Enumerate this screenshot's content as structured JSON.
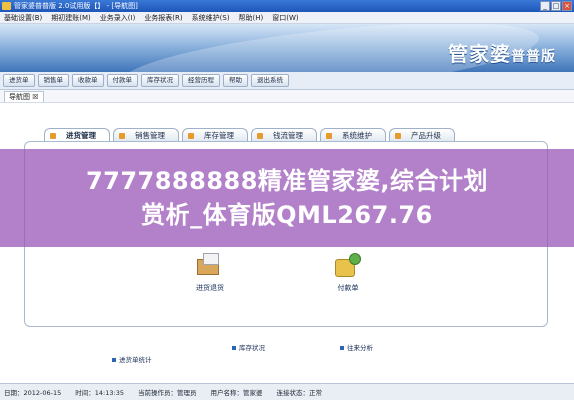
{
  "window": {
    "title": "管家婆普普版 2.0试用版【】 - [导航图]",
    "buttons": [
      "_",
      "□",
      "×"
    ]
  },
  "menubar": {
    "items": [
      "基础设置(B)",
      "期初建账(M)",
      "业务录入(I)",
      "业务报表(R)",
      "系统维护(S)",
      "帮助(H)",
      "窗口(W)"
    ]
  },
  "banner": {
    "logo_main": "管家婆",
    "logo_sub": "普普版"
  },
  "toolbar": {
    "buttons": [
      "进货单",
      "销售单",
      "收款单",
      "付款单",
      "库存状况",
      "经营历程",
      "帮助",
      "退出系统"
    ]
  },
  "navtab": {
    "label": "导航图 ☒"
  },
  "modules": {
    "tabs": [
      "进货管理",
      "销售管理",
      "库存管理",
      "钱流管理",
      "系统维护",
      "产品升级"
    ],
    "active_index": 0,
    "items": [
      {
        "label": "进货退货",
        "icon": "goods-box-icon"
      },
      {
        "label": "付款单",
        "icon": "coins-payment-icon"
      }
    ],
    "links": {
      "stock_status": "库存状况",
      "payables": "往来分析",
      "purchase_stats": "进货单统计"
    }
  },
  "watermark": {
    "line1": "7777888888精准管家婆,综合计划",
    "line2": "赏析_体育版QML267.76"
  },
  "statusbar": {
    "items": [
      "日期：2012-06-15",
      "时间：14:13:35",
      "当前操作员：管理员",
      "用户名称：管家婆",
      "连接状态：正常"
    ]
  },
  "colors": {
    "banner_dark": "#3f75b9",
    "watermark": "#9650b4",
    "accent": "#e79a2e"
  }
}
